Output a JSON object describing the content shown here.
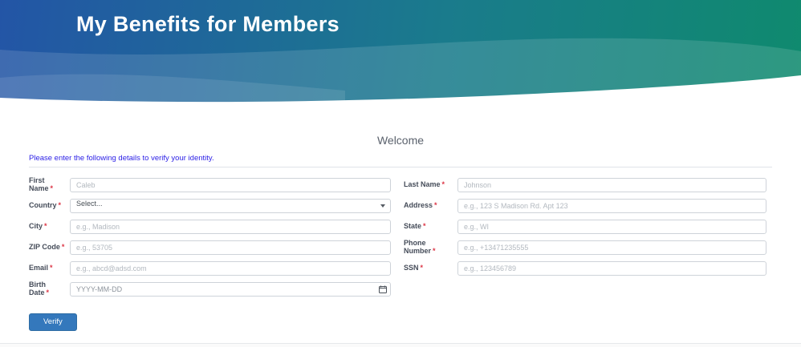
{
  "header": {
    "title": "My Benefits for Members"
  },
  "main": {
    "welcome_title": "Welcome",
    "instruction": "Please enter the following details to verify your identity."
  },
  "form": {
    "required_marker": "*",
    "left_fields": [
      {
        "label": "First Name",
        "placeholder": "Caleb",
        "type": "text"
      },
      {
        "label": "Country",
        "value": "Select...",
        "type": "select"
      },
      {
        "label": "City",
        "placeholder": "e.g., Madison",
        "type": "text"
      },
      {
        "label": "ZIP Code",
        "placeholder": "e.g., 53705",
        "type": "text"
      },
      {
        "label": "Email",
        "placeholder": "e.g., abcd@adsd.com",
        "type": "text"
      },
      {
        "label": "Birth Date",
        "placeholder": "YYYY-MM-DD",
        "type": "date"
      }
    ],
    "right_fields": [
      {
        "label": "Last Name",
        "placeholder": "Johnson",
        "type": "text"
      },
      {
        "label": "Address",
        "placeholder": "e.g., 123 S Madison Rd. Apt 123",
        "type": "text"
      },
      {
        "label": "State",
        "placeholder": "e.g., WI",
        "type": "text"
      },
      {
        "label": "Phone Number",
        "placeholder": "e.g., +13471235555",
        "type": "text"
      },
      {
        "label": "SSN",
        "placeholder": "e.g., 123456789",
        "type": "text"
      }
    ],
    "submit_label": "Verify"
  },
  "colors": {
    "header_gradient_start": "#2355a6",
    "header_gradient_mid": "#1a7b8c",
    "header_gradient_end": "#0f8a6e",
    "instruction_text": "#2a1ee6",
    "required_asterisk": "#dc3545",
    "button_background": "#3478bc",
    "input_border": "#ced3d9",
    "placeholder_text": "#b2b8bf"
  }
}
